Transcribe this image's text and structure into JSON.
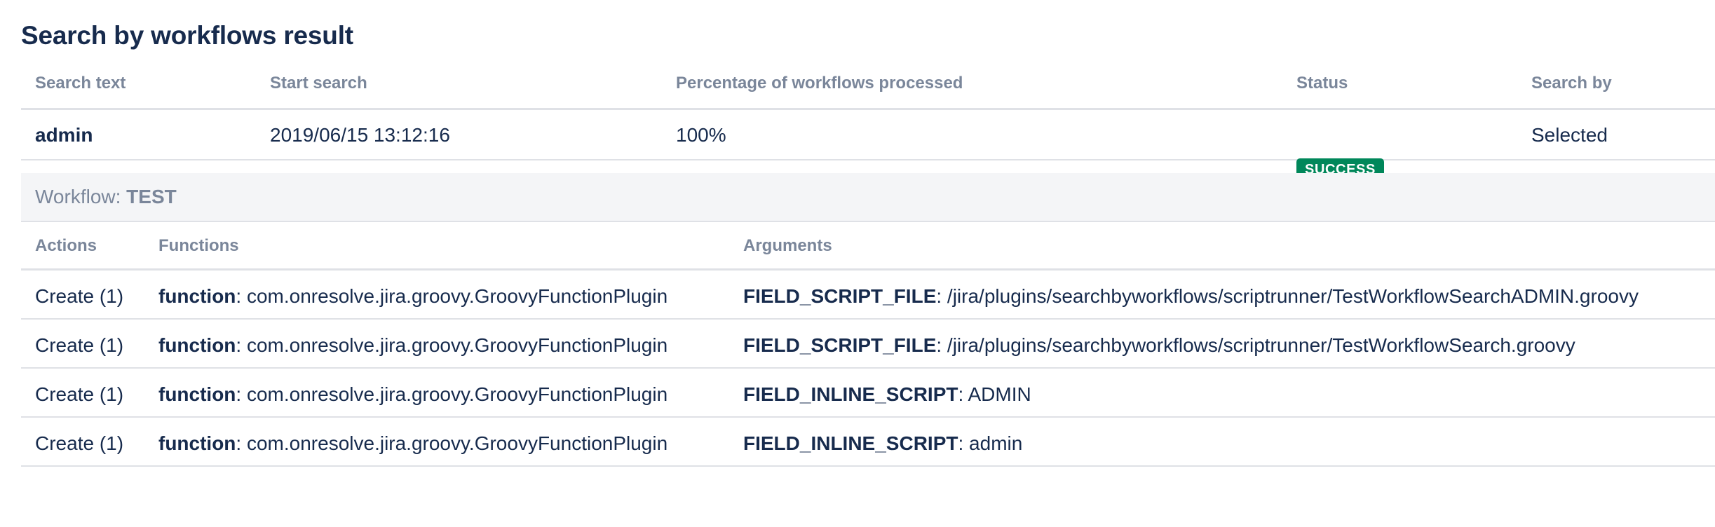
{
  "title": "Search by workflows result",
  "summary": {
    "headers": [
      "Search text",
      "Start search",
      "Percentage of workflows processed",
      "Status",
      "Search by"
    ],
    "row": {
      "search_text": "admin",
      "start_search": "2019/06/15 13:12:16",
      "percentage": "100%",
      "status": "SUCCESS",
      "search_by": "Selected"
    },
    "status_color": "#00875a"
  },
  "workflow": {
    "label": "Workflow: ",
    "name": "TEST",
    "headers": [
      "Actions",
      "Functions",
      "Arguments"
    ],
    "rows": [
      {
        "action": "Create (1)",
        "function_key": "function",
        "function_value": ": com.onresolve.jira.groovy.GroovyFunctionPlugin",
        "argument_key": "FIELD_SCRIPT_FILE",
        "argument_value": ": /jira/plugins/searchbyworkflows/scriptrunner/TestWorkflowSearchADMIN.groovy"
      },
      {
        "action": "Create (1)",
        "function_key": "function",
        "function_value": ": com.onresolve.jira.groovy.GroovyFunctionPlugin",
        "argument_key": "FIELD_SCRIPT_FILE",
        "argument_value": ": /jira/plugins/searchbyworkflows/scriptrunner/TestWorkflowSearch.groovy"
      },
      {
        "action": "Create (1)",
        "function_key": "function",
        "function_value": ": com.onresolve.jira.groovy.GroovyFunctionPlugin",
        "argument_key": "FIELD_INLINE_SCRIPT",
        "argument_value": ": ADMIN"
      },
      {
        "action": "Create (1)",
        "function_key": "function",
        "function_value": ": com.onresolve.jira.groovy.GroovyFunctionPlugin",
        "argument_key": "FIELD_INLINE_SCRIPT",
        "argument_value": ": admin"
      }
    ]
  }
}
